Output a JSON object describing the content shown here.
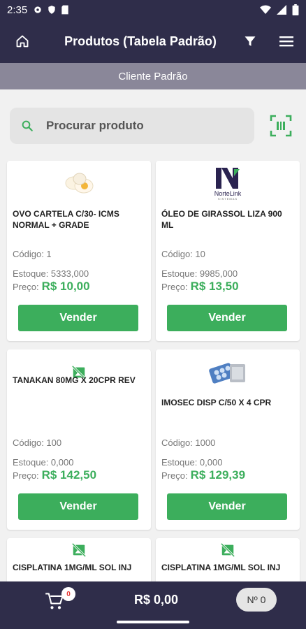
{
  "statusbar": {
    "time": "2:35"
  },
  "appbar": {
    "title": "Produtos (Tabela Padrão)"
  },
  "client": {
    "label": "Cliente Padrão"
  },
  "search": {
    "placeholder": "Procurar produto"
  },
  "products": [
    {
      "name": "OVO CARTELA C/30- ICMS NORMAL + GRADE",
      "code": "Código: 1",
      "stock": "Estoque: 5333,000",
      "price_label": "Preço:",
      "price": "R$ 10,00",
      "button": "Vender",
      "image": "eggs-image"
    },
    {
      "name": "ÓLEO DE GIRASSOL LIZA 900 ML",
      "code": "Código: 10",
      "stock": "Estoque: 9985,000",
      "price_label": "Preço:",
      "price": "R$ 13,50",
      "button": "Vender",
      "image": "nortelink-logo"
    },
    {
      "name": "TANAKAN 80MG X 20CPR REV",
      "code": "Código: 100",
      "stock": "Estoque: 0,000",
      "price_label": "Preço:",
      "price": "R$ 142,50",
      "button": "Vender",
      "image": "no-image-icon"
    },
    {
      "name": "IMOSEC DISP C/50 X 4 CPR",
      "code": "Código: 1000",
      "stock": "Estoque: 0,000",
      "price_label": "Preço:",
      "price": "R$ 129,39",
      "button": "Vender",
      "image": "blister-pack-image"
    },
    {
      "name": "CISPLATINA 1MG/ML SOL INJ",
      "image": "no-image-icon"
    },
    {
      "name": "CISPLATINA 1MG/ML SOL INJ",
      "image": "no-image-icon"
    }
  ],
  "logo_text": {
    "brand": "NorteLink",
    "sub": "SISTEMAS"
  },
  "bottombar": {
    "cart_count": "0",
    "total": "R$ 0,00",
    "order": "Nº 0"
  },
  "colors": {
    "primary": "#2f2d4a",
    "accent": "#3cae5c",
    "client_bar": "#8a8799"
  }
}
